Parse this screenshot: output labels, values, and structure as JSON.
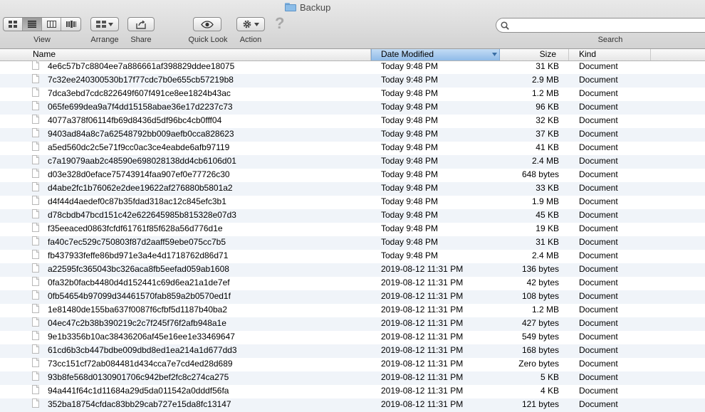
{
  "window": {
    "title": "Backup"
  },
  "toolbar": {
    "view_label": "View",
    "arrange_label": "Arrange",
    "share_label": "Share",
    "quicklook_label": "Quick Look",
    "action_label": "Action",
    "search_label": "Search",
    "help_glyph": "?",
    "search_value": ""
  },
  "columns": {
    "name": "Name",
    "date": "Date Modified",
    "size": "Size",
    "kind": "Kind"
  },
  "files": [
    {
      "name": "4e6c57b7c8804ee7a886661af398829ddee18075",
      "date": "Today 9:48 PM",
      "size": "31 KB",
      "kind": "Document"
    },
    {
      "name": "7c32ee240300530b17f77cdc7b0e655cb57219b8",
      "date": "Today 9:48 PM",
      "size": "2.9 MB",
      "kind": "Document"
    },
    {
      "name": "7dca3ebd7cdc822649f607f491ce8ee1824b43ac",
      "date": "Today 9:48 PM",
      "size": "1.2 MB",
      "kind": "Document"
    },
    {
      "name": "065fe699dea9a7f4dd15158abae36e17d2237c73",
      "date": "Today 9:48 PM",
      "size": "96 KB",
      "kind": "Document"
    },
    {
      "name": "4077a378f06114fb69d8436d5df96bc4cb0fff04",
      "date": "Today 9:48 PM",
      "size": "32 KB",
      "kind": "Document"
    },
    {
      "name": "9403ad84a8c7a62548792bb009aefb0cca828623",
      "date": "Today 9:48 PM",
      "size": "37 KB",
      "kind": "Document"
    },
    {
      "name": "a5ed560dc2c5e71f9cc0ac3ce4eabde6afb97119",
      "date": "Today 9:48 PM",
      "size": "41 KB",
      "kind": "Document"
    },
    {
      "name": "c7a19079aab2c48590e698028138dd4cb6106d01",
      "date": "Today 9:48 PM",
      "size": "2.4 MB",
      "kind": "Document"
    },
    {
      "name": "d03e328d0eface75743914faa907ef0e77726c30",
      "date": "Today 9:48 PM",
      "size": "648 bytes",
      "kind": "Document"
    },
    {
      "name": "d4abe2fc1b76062e2dee19622af276880b5801a2",
      "date": "Today 9:48 PM",
      "size": "33 KB",
      "kind": "Document"
    },
    {
      "name": "d4f44d4aedef0c87b35fdad318ac12c845efc3b1",
      "date": "Today 9:48 PM",
      "size": "1.9 MB",
      "kind": "Document"
    },
    {
      "name": "d78cbdb47bcd151c42e622645985b815328e07d3",
      "date": "Today 9:48 PM",
      "size": "45 KB",
      "kind": "Document"
    },
    {
      "name": "f35eeaced0863fcfdf61761f85f628a56d776d1e",
      "date": "Today 9:48 PM",
      "size": "19 KB",
      "kind": "Document"
    },
    {
      "name": "fa40c7ec529c750803f87d2aaff59ebe075cc7b5",
      "date": "Today 9:48 PM",
      "size": "31 KB",
      "kind": "Document"
    },
    {
      "name": "fb437933feffe86bd971e3a4e4d1718762d86d71",
      "date": "Today 9:48 PM",
      "size": "2.4 MB",
      "kind": "Document"
    },
    {
      "name": "a22595fc365043bc326aca8fb5eefad059ab1608",
      "date": "2019-08-12 11:31 PM",
      "size": "136 bytes",
      "kind": "Document"
    },
    {
      "name": "0fa32b0facb4480d4d152441c69d6ea21a1de7ef",
      "date": "2019-08-12 11:31 PM",
      "size": "42 bytes",
      "kind": "Document"
    },
    {
      "name": "0fb54654b97099d34461570fab859a2b0570ed1f",
      "date": "2019-08-12 11:31 PM",
      "size": "108 bytes",
      "kind": "Document"
    },
    {
      "name": "1e81480de155ba637f0087f6cfbf5d1187b40ba2",
      "date": "2019-08-12 11:31 PM",
      "size": "1.2 MB",
      "kind": "Document"
    },
    {
      "name": "04ec47c2b38b390219c2c7f245f76f2afb948a1e",
      "date": "2019-08-12 11:31 PM",
      "size": "427 bytes",
      "kind": "Document"
    },
    {
      "name": "9e1b3356b10ac38436206af45e16ee1e33469647",
      "date": "2019-08-12 11:31 PM",
      "size": "549 bytes",
      "kind": "Document"
    },
    {
      "name": "61cd6b3cb447bdbe009dbd8ed1ea214a1d677dd3",
      "date": "2019-08-12 11:31 PM",
      "size": "168 bytes",
      "kind": "Document"
    },
    {
      "name": "73cc151cf72ab084481d434cca7e7cd4ed28d689",
      "date": "2019-08-12 11:31 PM",
      "size": "Zero bytes",
      "kind": "Document"
    },
    {
      "name": "93b8fe568d0130901706c942bef2fc8c274ca275",
      "date": "2019-08-12 11:31 PM",
      "size": "5 KB",
      "kind": "Document"
    },
    {
      "name": "94a441f64c1d11684a29d5da011542a0dddf56fa",
      "date": "2019-08-12 11:31 PM",
      "size": "4 KB",
      "kind": "Document"
    },
    {
      "name": "352ba18754cfdac83bb29cab727e15da8fc13147",
      "date": "2019-08-12 11:31 PM",
      "size": "121 bytes",
      "kind": "Document"
    }
  ]
}
